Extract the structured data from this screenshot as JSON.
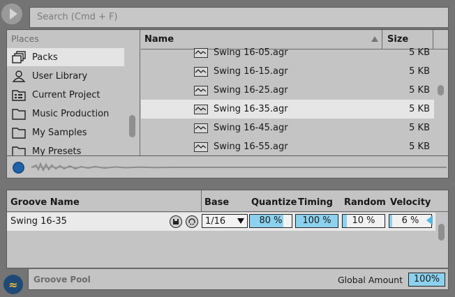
{
  "search": {
    "placeholder": "Search (Cmd + F)"
  },
  "places": {
    "title": "Places",
    "items": [
      {
        "label": "Packs",
        "icon": "packs-icon",
        "selected": true
      },
      {
        "label": "User Library",
        "icon": "user-icon",
        "selected": false
      },
      {
        "label": "Current Project",
        "icon": "project-icon",
        "selected": false
      },
      {
        "label": "Music Production",
        "icon": "folder-icon",
        "selected": false
      },
      {
        "label": "My Samples",
        "icon": "folder-icon",
        "selected": false
      },
      {
        "label": "My Presets",
        "icon": "folder-icon",
        "selected": false
      }
    ]
  },
  "files": {
    "header": {
      "name": "Name",
      "size": "Size"
    },
    "rows": [
      {
        "name": "Swing 16-05.agr",
        "size": "5 KB",
        "selected": false
      },
      {
        "name": "Swing 16-15.agr",
        "size": "5 KB",
        "selected": false
      },
      {
        "name": "Swing 16-25.agr",
        "size": "5 KB",
        "selected": false
      },
      {
        "name": "Swing 16-35.agr",
        "size": "5 KB",
        "selected": true
      },
      {
        "name": "Swing 16-45.agr",
        "size": "5 KB",
        "selected": false
      },
      {
        "name": "Swing 16-55.agr",
        "size": "5 KB",
        "selected": false
      }
    ]
  },
  "groove": {
    "columns": {
      "name": "Groove Name",
      "base": "Base",
      "quantize": "Quantize",
      "timing": "Timing",
      "random": "Random",
      "velocity": "Velocity"
    },
    "row": {
      "name": "Swing 16-35",
      "base": "1/16",
      "quantize": "80 %",
      "timing": "100 %",
      "random": "10 %",
      "velocity": "6 %",
      "quantize_level": 0.8,
      "timing_level": 1.0,
      "random_level": 0.1,
      "velocity_level": 0.06
    },
    "footer": {
      "title": "Groove Pool",
      "global_label": "Global Amount",
      "global_value": "100%"
    }
  },
  "colors": {
    "accent": "#8cd2ef",
    "selection": "#e6e6e6",
    "panel": "#c4c4c4",
    "background": "#747474",
    "groove_toggle": "#1f4a77"
  }
}
